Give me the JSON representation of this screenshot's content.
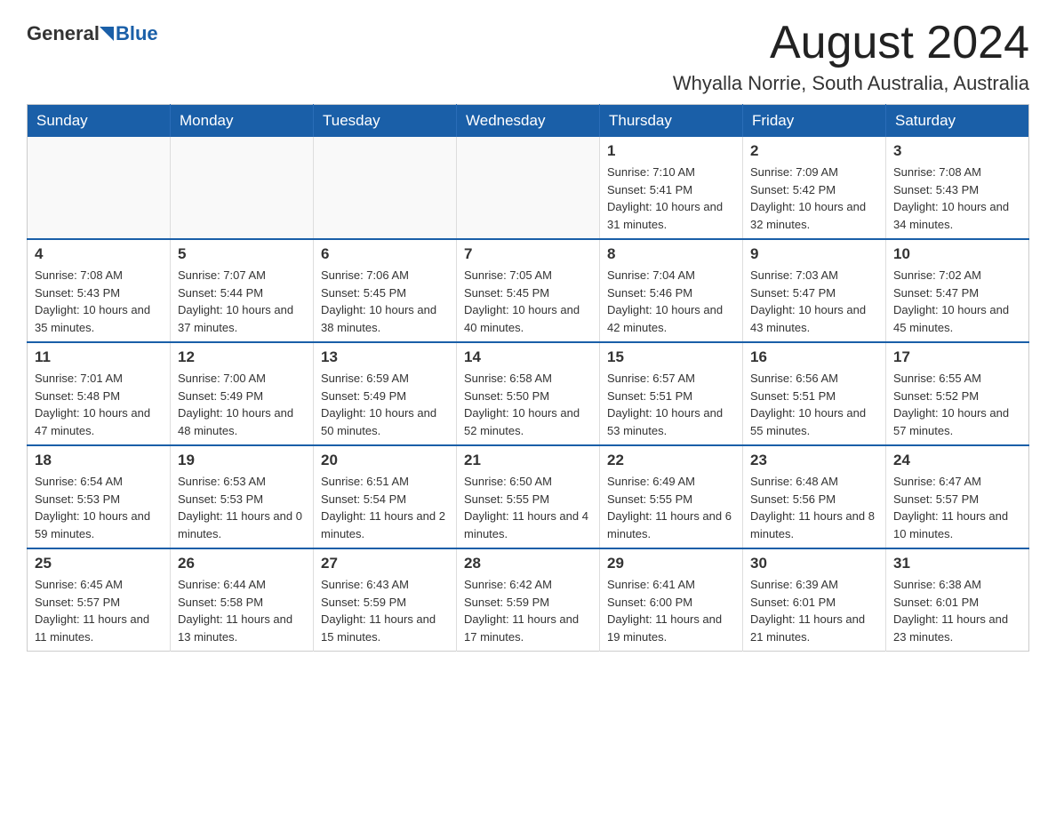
{
  "header": {
    "logo": {
      "general": "General",
      "blue": "Blue",
      "arrow_color": "#1a5fa8"
    },
    "title": "August 2024",
    "location": "Whyalla Norrie, South Australia, Australia"
  },
  "calendar": {
    "days_of_week": [
      "Sunday",
      "Monday",
      "Tuesday",
      "Wednesday",
      "Thursday",
      "Friday",
      "Saturday"
    ],
    "weeks": [
      [
        {
          "day": "",
          "info": ""
        },
        {
          "day": "",
          "info": ""
        },
        {
          "day": "",
          "info": ""
        },
        {
          "day": "",
          "info": ""
        },
        {
          "day": "1",
          "info": "Sunrise: 7:10 AM\nSunset: 5:41 PM\nDaylight: 10 hours and 31 minutes."
        },
        {
          "day": "2",
          "info": "Sunrise: 7:09 AM\nSunset: 5:42 PM\nDaylight: 10 hours and 32 minutes."
        },
        {
          "day": "3",
          "info": "Sunrise: 7:08 AM\nSunset: 5:43 PM\nDaylight: 10 hours and 34 minutes."
        }
      ],
      [
        {
          "day": "4",
          "info": "Sunrise: 7:08 AM\nSunset: 5:43 PM\nDaylight: 10 hours and 35 minutes."
        },
        {
          "day": "5",
          "info": "Sunrise: 7:07 AM\nSunset: 5:44 PM\nDaylight: 10 hours and 37 minutes."
        },
        {
          "day": "6",
          "info": "Sunrise: 7:06 AM\nSunset: 5:45 PM\nDaylight: 10 hours and 38 minutes."
        },
        {
          "day": "7",
          "info": "Sunrise: 7:05 AM\nSunset: 5:45 PM\nDaylight: 10 hours and 40 minutes."
        },
        {
          "day": "8",
          "info": "Sunrise: 7:04 AM\nSunset: 5:46 PM\nDaylight: 10 hours and 42 minutes."
        },
        {
          "day": "9",
          "info": "Sunrise: 7:03 AM\nSunset: 5:47 PM\nDaylight: 10 hours and 43 minutes."
        },
        {
          "day": "10",
          "info": "Sunrise: 7:02 AM\nSunset: 5:47 PM\nDaylight: 10 hours and 45 minutes."
        }
      ],
      [
        {
          "day": "11",
          "info": "Sunrise: 7:01 AM\nSunset: 5:48 PM\nDaylight: 10 hours and 47 minutes."
        },
        {
          "day": "12",
          "info": "Sunrise: 7:00 AM\nSunset: 5:49 PM\nDaylight: 10 hours and 48 minutes."
        },
        {
          "day": "13",
          "info": "Sunrise: 6:59 AM\nSunset: 5:49 PM\nDaylight: 10 hours and 50 minutes."
        },
        {
          "day": "14",
          "info": "Sunrise: 6:58 AM\nSunset: 5:50 PM\nDaylight: 10 hours and 52 minutes."
        },
        {
          "day": "15",
          "info": "Sunrise: 6:57 AM\nSunset: 5:51 PM\nDaylight: 10 hours and 53 minutes."
        },
        {
          "day": "16",
          "info": "Sunrise: 6:56 AM\nSunset: 5:51 PM\nDaylight: 10 hours and 55 minutes."
        },
        {
          "day": "17",
          "info": "Sunrise: 6:55 AM\nSunset: 5:52 PM\nDaylight: 10 hours and 57 minutes."
        }
      ],
      [
        {
          "day": "18",
          "info": "Sunrise: 6:54 AM\nSunset: 5:53 PM\nDaylight: 10 hours and 59 minutes."
        },
        {
          "day": "19",
          "info": "Sunrise: 6:53 AM\nSunset: 5:53 PM\nDaylight: 11 hours and 0 minutes."
        },
        {
          "day": "20",
          "info": "Sunrise: 6:51 AM\nSunset: 5:54 PM\nDaylight: 11 hours and 2 minutes."
        },
        {
          "day": "21",
          "info": "Sunrise: 6:50 AM\nSunset: 5:55 PM\nDaylight: 11 hours and 4 minutes."
        },
        {
          "day": "22",
          "info": "Sunrise: 6:49 AM\nSunset: 5:55 PM\nDaylight: 11 hours and 6 minutes."
        },
        {
          "day": "23",
          "info": "Sunrise: 6:48 AM\nSunset: 5:56 PM\nDaylight: 11 hours and 8 minutes."
        },
        {
          "day": "24",
          "info": "Sunrise: 6:47 AM\nSunset: 5:57 PM\nDaylight: 11 hours and 10 minutes."
        }
      ],
      [
        {
          "day": "25",
          "info": "Sunrise: 6:45 AM\nSunset: 5:57 PM\nDaylight: 11 hours and 11 minutes."
        },
        {
          "day": "26",
          "info": "Sunrise: 6:44 AM\nSunset: 5:58 PM\nDaylight: 11 hours and 13 minutes."
        },
        {
          "day": "27",
          "info": "Sunrise: 6:43 AM\nSunset: 5:59 PM\nDaylight: 11 hours and 15 minutes."
        },
        {
          "day": "28",
          "info": "Sunrise: 6:42 AM\nSunset: 5:59 PM\nDaylight: 11 hours and 17 minutes."
        },
        {
          "day": "29",
          "info": "Sunrise: 6:41 AM\nSunset: 6:00 PM\nDaylight: 11 hours and 19 minutes."
        },
        {
          "day": "30",
          "info": "Sunrise: 6:39 AM\nSunset: 6:01 PM\nDaylight: 11 hours and 21 minutes."
        },
        {
          "day": "31",
          "info": "Sunrise: 6:38 AM\nSunset: 6:01 PM\nDaylight: 11 hours and 23 minutes."
        }
      ]
    ]
  }
}
